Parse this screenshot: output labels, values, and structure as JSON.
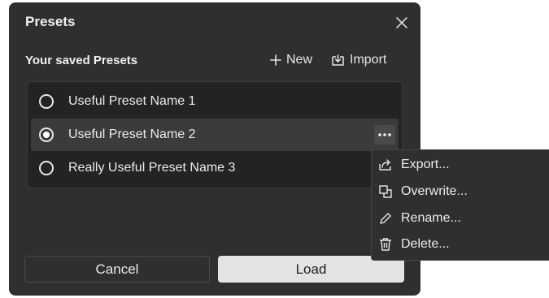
{
  "dialog": {
    "title": "Presets",
    "subtitle": "Your saved Presets",
    "new_label": "New",
    "import_label": "Import"
  },
  "presets": [
    {
      "name": "Useful Preset Name 1",
      "selected": false
    },
    {
      "name": "Useful Preset Name 2",
      "selected": true
    },
    {
      "name": "Really Useful Preset Name 3",
      "selected": false
    }
  ],
  "buttons": {
    "cancel": "Cancel",
    "load": "Load"
  },
  "context_menu": {
    "items": [
      {
        "label": "Export...",
        "icon": "export-icon"
      },
      {
        "label": "Overwrite...",
        "icon": "overwrite-icon"
      },
      {
        "label": "Rename...",
        "icon": "pencil-icon"
      },
      {
        "label": "Delete...",
        "icon": "trash-icon"
      }
    ]
  }
}
